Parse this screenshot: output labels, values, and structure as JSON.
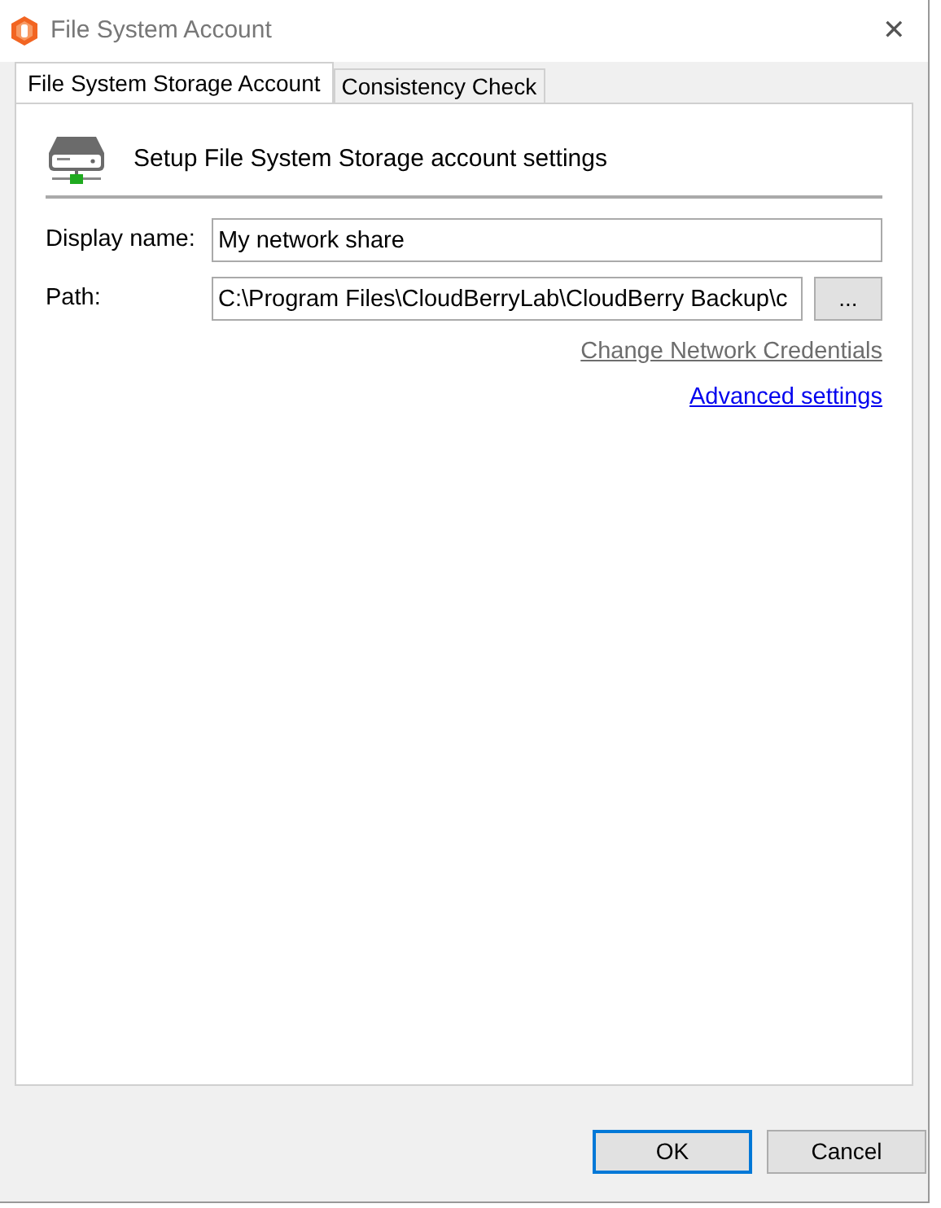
{
  "window": {
    "title": "File System Account",
    "close": "✕"
  },
  "tabs": [
    {
      "label": "File System Storage Account",
      "selected": true
    },
    {
      "label": "Consistency Check",
      "selected": false
    }
  ],
  "header": {
    "text": "Setup File System Storage account settings"
  },
  "fields": [
    {
      "label": "Display name:",
      "value": "My network share"
    },
    {
      "label": "Path:",
      "value": "C:\\Program Files\\CloudBerryLab\\CloudBerry Backup\\c",
      "browse": "..."
    }
  ],
  "links": [
    {
      "label": "Change Network Credentials",
      "disabled": true
    },
    {
      "label": "Advanced settings",
      "disabled": false
    }
  ],
  "buttons": [
    {
      "label": "OK",
      "default": true
    },
    {
      "label": "Cancel",
      "default": false
    }
  ]
}
